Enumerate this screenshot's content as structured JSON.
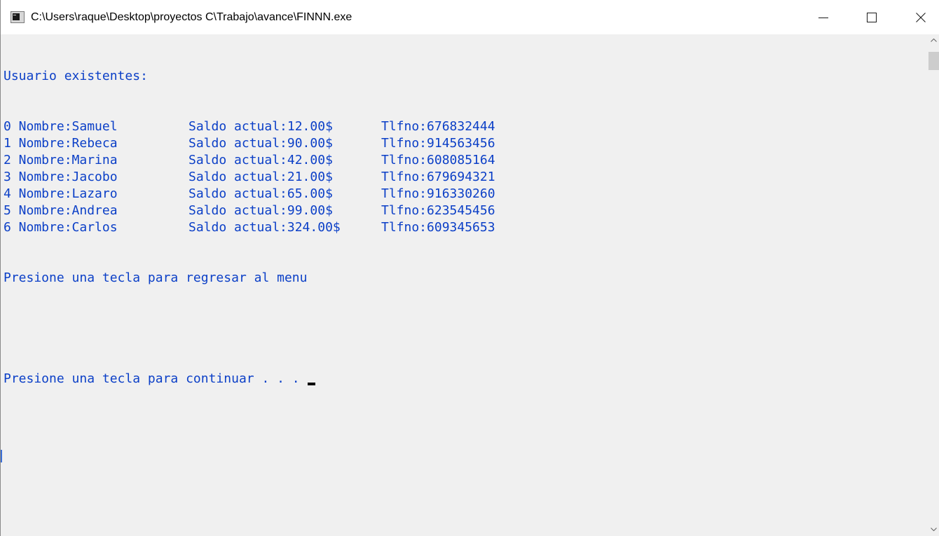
{
  "window": {
    "title": "C:\\Users\\raque\\Desktop\\proyectos C\\Trabajo\\avance\\FINNN.exe"
  },
  "controls": {
    "minimize": "minimize",
    "maximize": "maximize",
    "close": "close"
  },
  "console": {
    "header": "Usuario existentes:",
    "rows": [
      {
        "nombre": "0 Nombre:Samuel",
        "saldo": "Saldo actual:12.00$",
        "tlfno": "Tlfno:676832444"
      },
      {
        "nombre": "1 Nombre:Rebeca",
        "saldo": "Saldo actual:90.00$",
        "tlfno": "Tlfno:914563456"
      },
      {
        "nombre": "2 Nombre:Marina",
        "saldo": "Saldo actual:42.00$",
        "tlfno": "Tlfno:608085164"
      },
      {
        "nombre": "3 Nombre:Jacobo",
        "saldo": "Saldo actual:21.00$",
        "tlfno": "Tlfno:679694321"
      },
      {
        "nombre": "4 Nombre:Lazaro",
        "saldo": "Saldo actual:65.00$",
        "tlfno": "Tlfno:916330260"
      },
      {
        "nombre": "5 Nombre:Andrea",
        "saldo": "Saldo actual:99.00$",
        "tlfno": "Tlfno:623545456"
      },
      {
        "nombre": "6 Nombre:Carlos",
        "saldo": "Saldo actual:324.00$",
        "tlfno": "Tlfno:609345653"
      }
    ],
    "prompt_menu": "Presione una tecla para regresar al menu",
    "prompt_continue": "Presione una tecla para continuar . . . "
  },
  "colors": {
    "console_text": "#0b3fc7",
    "console_bg": "#f0f0f0",
    "titlebar_bg": "#ffffff"
  }
}
